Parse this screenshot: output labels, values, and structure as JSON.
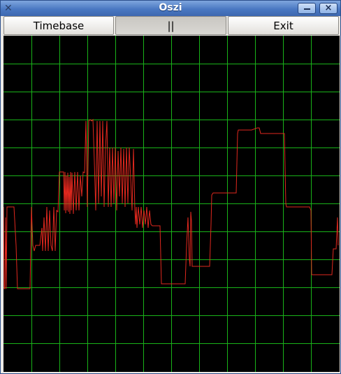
{
  "window": {
    "title": "Oszi"
  },
  "toolbar": {
    "timebase_label": "Timebase",
    "pause_label": "||",
    "exit_label": "Exit"
  },
  "icons": {
    "app": "oscilloscope-icon",
    "minimize": "minimize-icon",
    "close": "close-icon"
  },
  "colors": {
    "grid": "#19b319",
    "trace": "#e0281e",
    "background": "#000000"
  },
  "scope": {
    "grid_divisions": 12
  }
}
